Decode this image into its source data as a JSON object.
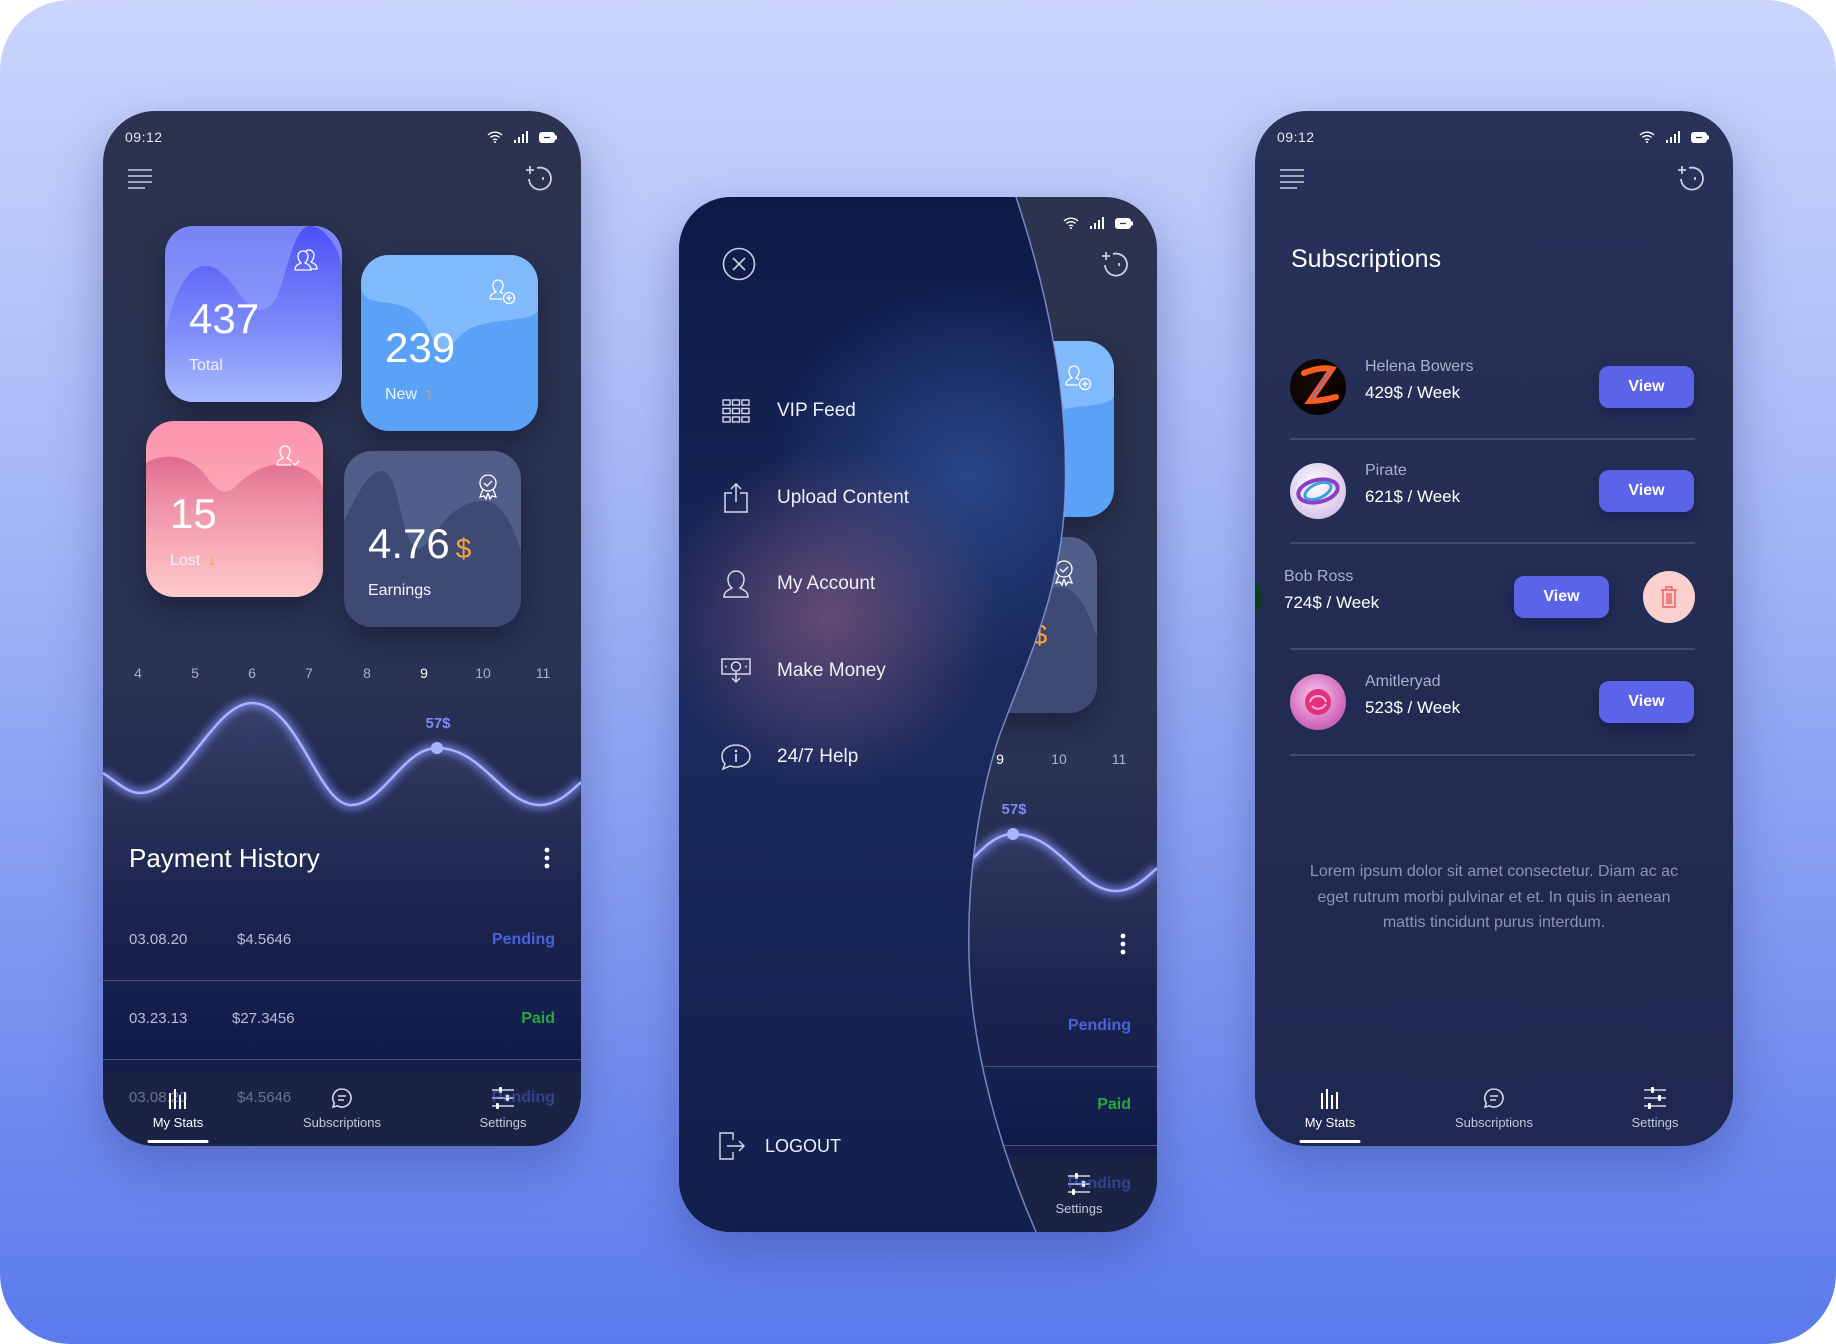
{
  "status_bar": {
    "time": "09:12"
  },
  "stats": {
    "cards": [
      {
        "value": "437",
        "label": "Total"
      },
      {
        "value": "239",
        "label": "New"
      },
      {
        "value": "15",
        "label": "Lost"
      },
      {
        "value": "4.76",
        "currency": "$",
        "label": "Earnings"
      }
    ]
  },
  "chart": {
    "x_labels": [
      "4",
      "5",
      "6",
      "7",
      "8",
      "9",
      "10",
      "11"
    ],
    "selected_label": "9",
    "highlight_value": "57$"
  },
  "payment_history": {
    "title": "Payment History",
    "rows": [
      {
        "date": "03.08.20",
        "amount": "$4.5646",
        "status": "Pending"
      },
      {
        "date": "03.23.13",
        "amount": "$27.3456",
        "status": "Paid"
      },
      {
        "date": "03.08.20",
        "amount": "$4.5646",
        "status": "Pending"
      }
    ]
  },
  "nav": {
    "items": [
      "My Stats",
      "Subscriptions",
      "Settings"
    ],
    "active": "My Stats"
  },
  "drawer": {
    "items": [
      "VIP Feed",
      "Upload Content",
      "My Account",
      "Make Money",
      "24/7 Help"
    ],
    "logout": "LOGOUT"
  },
  "subscriptions": {
    "title": "Subscriptions",
    "view_label": "View",
    "items": [
      {
        "name": "Helena Bowers",
        "price": "429$ / Week"
      },
      {
        "name": "Pirate",
        "price": "621$ / Week"
      },
      {
        "name": "Bob Ross",
        "price": "724$ / Week"
      },
      {
        "name": "Amitleryad",
        "price": "523$ / Week"
      }
    ],
    "description": "Lorem ipsum dolor sit amet consectetur. Diam ac ac eget rutrum morbi pulvinar et et. In quis in aenean mattis tincidunt purus interdum."
  },
  "colors": {
    "accent": "#5b63e8",
    "pending": "#4a63d8",
    "paid": "#27a83a",
    "arrow": "#f5a33a",
    "delete_bg": "#fdd0d0",
    "delete_icon": "#e74c4c"
  }
}
